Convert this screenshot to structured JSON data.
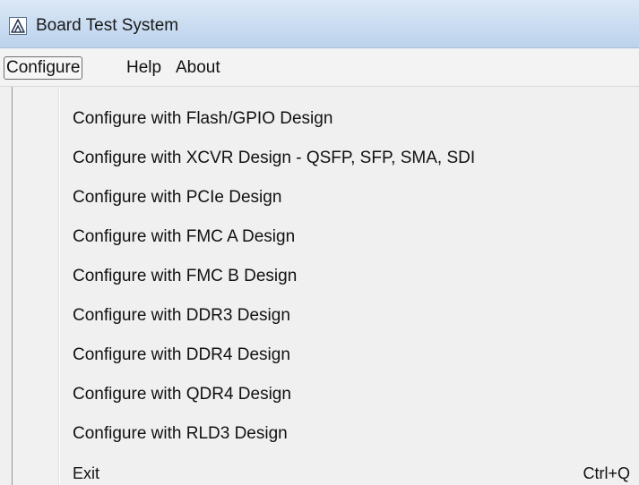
{
  "window": {
    "title": "Board Test System",
    "icon": "altera-a-icon"
  },
  "menubar": {
    "items": [
      {
        "label": "Configure",
        "active": true
      },
      {
        "label": "Help",
        "active": false
      },
      {
        "label": "About",
        "active": false
      }
    ]
  },
  "dropdown": {
    "items": [
      {
        "label": "Configure with Flash/GPIO Design",
        "shortcut": ""
      },
      {
        "label": "Configure with XCVR Design - QSFP, SFP, SMA, SDI",
        "shortcut": ""
      },
      {
        "label": "Configure with PCIe Design",
        "shortcut": ""
      },
      {
        "label": "Configure with FMC A Design",
        "shortcut": ""
      },
      {
        "label": "Configure with FMC B Design",
        "shortcut": ""
      },
      {
        "label": "Configure with DDR3 Design",
        "shortcut": ""
      },
      {
        "label": "Configure with DDR4 Design",
        "shortcut": ""
      },
      {
        "label": "Configure with QDR4 Design",
        "shortcut": ""
      },
      {
        "label": "Configure with RLD3 Design",
        "shortcut": ""
      },
      {
        "label": "Exit",
        "shortcut": "Ctrl+Q"
      }
    ]
  }
}
